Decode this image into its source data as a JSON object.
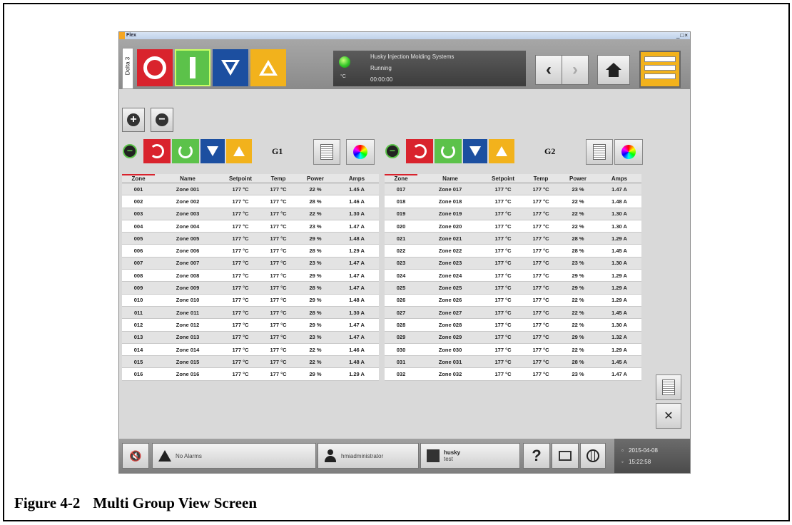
{
  "window": {
    "title": "Flex",
    "controls": "_□×"
  },
  "header": {
    "machine_tab": "Delta 3",
    "status": {
      "company": "Husky Injection Molding Systems",
      "state": "Running",
      "unit": "°C",
      "timer": "00:00:00"
    }
  },
  "groups": [
    {
      "label": "G1",
      "columns": [
        "Zone",
        "Name",
        "Setpoint",
        "Temp",
        "Power",
        "Amps"
      ],
      "rows": [
        [
          "001",
          "Zone 001",
          "177 °C",
          "177 °C",
          "22 %",
          "1.45 A"
        ],
        [
          "002",
          "Zone 002",
          "177 °C",
          "177 °C",
          "28 %",
          "1.46 A"
        ],
        [
          "003",
          "Zone 003",
          "177 °C",
          "177 °C",
          "22 %",
          "1.30 A"
        ],
        [
          "004",
          "Zone 004",
          "177 °C",
          "177 °C",
          "23 %",
          "1.47 A"
        ],
        [
          "005",
          "Zone 005",
          "177 °C",
          "177 °C",
          "29 %",
          "1.48 A"
        ],
        [
          "006",
          "Zone 006",
          "177 °C",
          "177 °C",
          "28 %",
          "1.29 A"
        ],
        [
          "007",
          "Zone 007",
          "177 °C",
          "177 °C",
          "23 %",
          "1.47 A"
        ],
        [
          "008",
          "Zone 008",
          "177 °C",
          "177 °C",
          "29 %",
          "1.47 A"
        ],
        [
          "009",
          "Zone 009",
          "177 °C",
          "177 °C",
          "28 %",
          "1.47 A"
        ],
        [
          "010",
          "Zone 010",
          "177 °C",
          "177 °C",
          "29 %",
          "1.48 A"
        ],
        [
          "011",
          "Zone 011",
          "177 °C",
          "177 °C",
          "28 %",
          "1.30 A"
        ],
        [
          "012",
          "Zone 012",
          "177 °C",
          "177 °C",
          "29 %",
          "1.47 A"
        ],
        [
          "013",
          "Zone 013",
          "177 °C",
          "177 °C",
          "23 %",
          "1.47 A"
        ],
        [
          "014",
          "Zone 014",
          "177 °C",
          "177 °C",
          "22 %",
          "1.46 A"
        ],
        [
          "015",
          "Zone 015",
          "177 °C",
          "177 °C",
          "22 %",
          "1.48 A"
        ],
        [
          "016",
          "Zone 016",
          "177 °C",
          "177 °C",
          "29 %",
          "1.29 A"
        ]
      ]
    },
    {
      "label": "G2",
      "columns": [
        "Zone",
        "Name",
        "Setpoint",
        "Temp",
        "Power",
        "Amps"
      ],
      "rows": [
        [
          "017",
          "Zone 017",
          "177 °C",
          "177 °C",
          "23 %",
          "1.47 A"
        ],
        [
          "018",
          "Zone 018",
          "177 °C",
          "177 °C",
          "22 %",
          "1.48 A"
        ],
        [
          "019",
          "Zone 019",
          "177 °C",
          "177 °C",
          "22 %",
          "1.30 A"
        ],
        [
          "020",
          "Zone 020",
          "177 °C",
          "177 °C",
          "22 %",
          "1.30 A"
        ],
        [
          "021",
          "Zone 021",
          "177 °C",
          "177 °C",
          "28 %",
          "1.29 A"
        ],
        [
          "022",
          "Zone 022",
          "177 °C",
          "177 °C",
          "28 %",
          "1.45 A"
        ],
        [
          "023",
          "Zone 023",
          "177 °C",
          "177 °C",
          "23 %",
          "1.30 A"
        ],
        [
          "024",
          "Zone 024",
          "177 °C",
          "177 °C",
          "29 %",
          "1.29 A"
        ],
        [
          "025",
          "Zone 025",
          "177 °C",
          "177 °C",
          "29 %",
          "1.29 A"
        ],
        [
          "026",
          "Zone 026",
          "177 °C",
          "177 °C",
          "22 %",
          "1.29 A"
        ],
        [
          "027",
          "Zone 027",
          "177 °C",
          "177 °C",
          "22 %",
          "1.45 A"
        ],
        [
          "028",
          "Zone 028",
          "177 °C",
          "177 °C",
          "22 %",
          "1.30 A"
        ],
        [
          "029",
          "Zone 029",
          "177 °C",
          "177 °C",
          "29 %",
          "1.32 A"
        ],
        [
          "030",
          "Zone 030",
          "177 °C",
          "177 °C",
          "22 %",
          "1.29 A"
        ],
        [
          "031",
          "Zone 031",
          "177 °C",
          "177 °C",
          "28 %",
          "1.45 A"
        ],
        [
          "032",
          "Zone 032",
          "177 °C",
          "177 °C",
          "23 %",
          "1.47 A"
        ]
      ]
    }
  ],
  "footer": {
    "alarm_text": "No Alarms",
    "user": "hmiadministrator",
    "project_name": "husky",
    "project_sub": "test",
    "help": "?",
    "date": "2015-04-08",
    "time": "15:22:58"
  },
  "caption": {
    "number": "Figure 4-2",
    "title": "Multi Group View Screen"
  },
  "colors": {
    "stop": "#d9232d",
    "run": "#5cc24a",
    "down": "#1c4fa0",
    "up": "#f2b21c"
  }
}
